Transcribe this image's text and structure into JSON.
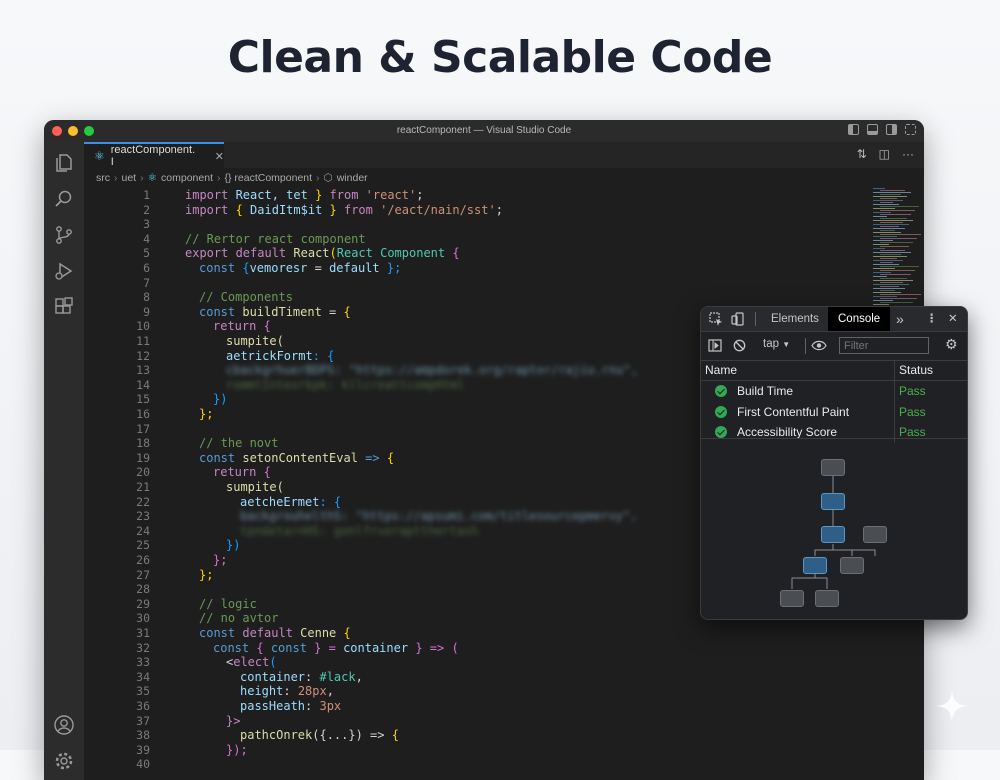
{
  "headline": "Clean & Scalable Code",
  "window": {
    "title": "reactComponent — Visual Studio Code",
    "traffic_colors": [
      "#ff5f57",
      "#febc2e",
      "#28c840"
    ]
  },
  "tab": {
    "label": "reactComponent. I",
    "close": "✕"
  },
  "breadcrumb": [
    "src",
    "uet",
    "component",
    "{} reactComponent",
    "winder"
  ],
  "code_lines": [
    {
      "n": "1"
    },
    {
      "n": "2"
    },
    {
      "n": "3"
    },
    {
      "n": "4"
    },
    {
      "n": "5"
    },
    {
      "n": "6"
    },
    {
      "n": "7"
    },
    {
      "n": "8"
    },
    {
      "n": "9"
    },
    {
      "n": "10"
    },
    {
      "n": "11"
    },
    {
      "n": "12"
    },
    {
      "n": "13"
    },
    {
      "n": "14"
    },
    {
      "n": "15"
    },
    {
      "n": "16"
    },
    {
      "n": "17"
    },
    {
      "n": "18"
    },
    {
      "n": "19"
    },
    {
      "n": "20"
    },
    {
      "n": "21"
    },
    {
      "n": "22"
    },
    {
      "n": "23"
    },
    {
      "n": "24"
    },
    {
      "n": "25"
    },
    {
      "n": "26"
    },
    {
      "n": "27"
    },
    {
      "n": "28"
    },
    {
      "n": "29"
    },
    {
      "n": "30"
    },
    {
      "n": "31"
    },
    {
      "n": "32"
    },
    {
      "n": "33"
    },
    {
      "n": "34"
    },
    {
      "n": "35"
    },
    {
      "n": "36"
    },
    {
      "n": "37"
    },
    {
      "n": "38"
    },
    {
      "n": "39"
    },
    {
      "n": "40"
    }
  ],
  "code": {
    "l1_a": "import",
    "l1_b": " React, tet ",
    "l1_c": "}",
    "l1_d": " from ",
    "l1_e": "'react'",
    "l1_f": ";",
    "l2_a": "import",
    "l2_b": " { ",
    "l2_c": "DaidItm$it",
    "l2_d": " } ",
    "l2_e": "from ",
    "l2_f": "'/eact/nain/sst'",
    "l2_g": ";",
    "l4": "// Rertor react component",
    "l5_a": "export",
    "l5_b": " default ",
    "l5_c": "React",
    "l5_d": "(",
    "l5_e": "React Component",
    "l5_f": " {",
    "l6_a": "const",
    "l6_b": " {",
    "l6_c": "vemoresr",
    "l6_d": " = ",
    "l6_e": "default",
    "l6_f": " };",
    "l8": "// Components",
    "l9_a": "const",
    "l9_b": " buildTiment",
    "l9_c": " = ",
    "l9_d": "{",
    "l10_a": "return",
    "l10_b": " {",
    "l11": "sumpite(",
    "l12_a": "aetrickFormt",
    "l12_b": ": {",
    "l13": "cbackgrhuerBDPS: \"https://ampdorek.org/raptor/rajiu.rnu\",",
    "l14": "rommtIntexrkpk: kllcreattcompHtml",
    "l15": "})",
    "l16": "};",
    "l18": "// the novt",
    "l19_a": "const",
    "l19_b": " setonContentEval",
    "l19_c": " => ",
    "l19_d": "{",
    "l20_a": "return",
    "l20_b": " {",
    "l21": "sumpite(",
    "l22_a": "aetcheErmet",
    "l22_b": ": {",
    "l23": "backgrouhelthS: \"https://apsumi.com/titlesourcepmervy\",",
    "l24": "tpndetarnHS: gonlfrveraptthertash",
    "l25": "})",
    "l26": "};",
    "l27": "};",
    "l29": "// logic",
    "l30": "// no avtor",
    "l31_a": "const",
    "l31_b": " default ",
    "l31_c": "Cenne",
    "l31_d": " {",
    "l32_a": "const",
    "l32_b": " { ",
    "l32_c": "const",
    "l32_d": " } = ",
    "l32_e": "container",
    "l32_f": " } => (",
    "l33_a": "<",
    "l33_b": "elect",
    "l33_c": "(",
    "l34_a": "container",
    "l34_b": ": ",
    "l34_c": "#lack",
    "l34_d": ",",
    "l35_a": "height",
    "l35_b": ": ",
    "l35_c": "28px",
    "l35_d": ",",
    "l36_a": "passHeath",
    "l36_b": ": ",
    "l36_c": "3px",
    "l37": "}>",
    "l38_a": "pathcOnrek",
    "l38_b": "({...}) => ",
    "l38_c": "{",
    "l39": "});"
  },
  "devtools": {
    "tabs": [
      "Elements",
      "Console"
    ],
    "active_tab": "Console",
    "more": "»",
    "context": "tap",
    "filter_placeholder": "Filter",
    "columns": [
      "Name",
      "Status"
    ],
    "rows": [
      {
        "name": "Build Time",
        "status": "Pass"
      },
      {
        "name": "First Contentful Paint",
        "status": "Pass"
      },
      {
        "name": "Accessibility Score",
        "status": "Pass"
      }
    ],
    "pass_color": "#4caf50"
  }
}
